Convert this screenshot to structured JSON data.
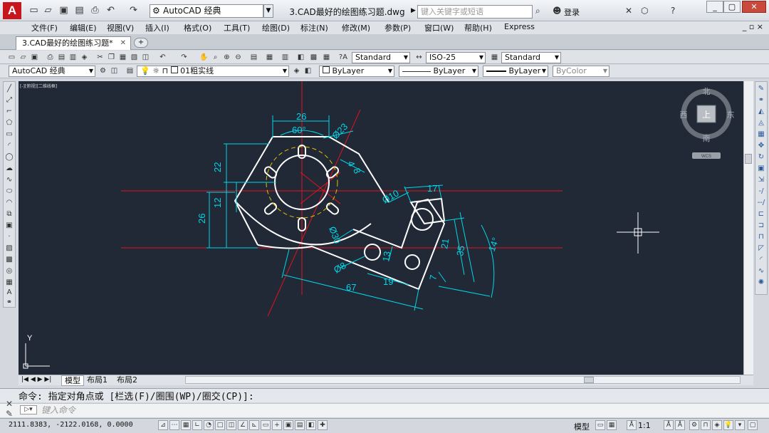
{
  "app": {
    "logo_letter": "A",
    "workspace": "AutoCAD 经典",
    "document_title": "3.CAD最好的绘图练习题.dwg",
    "search_placeholder": "键入关键字或短语",
    "login": "登录"
  },
  "menu": [
    "文件(F)",
    "编辑(E)",
    "视图(V)",
    "插入(I)",
    "格式(O)",
    "工具(T)",
    "绘图(D)",
    "标注(N)",
    "修改(M)",
    "参数(P)",
    "窗口(W)",
    "帮助(H)",
    "Express"
  ],
  "tabs": {
    "active": "3.CAD最好的绘图练习题*"
  },
  "styles": {
    "text_style": "Standard",
    "dim_style": "ISO-25",
    "table_style": "Standard"
  },
  "layers": {
    "workspace": "AutoCAD 经典",
    "current_layer": "01粗实线",
    "color": "ByLayer",
    "linetype": "ByLayer",
    "lineweight": "ByLayer",
    "plot_style": "ByColor"
  },
  "viewcube": {
    "north": "北",
    "south": "南",
    "west": "西",
    "east": "东",
    "top": "上",
    "wcs": "WCS"
  },
  "dimensions": {
    "d26_top": "26",
    "d60deg": "60°",
    "d23": "Ø23",
    "d22": "22",
    "d12": "12",
    "d26_left": "26",
    "d4": "4",
    "d8": "8",
    "d10": "Ø10",
    "d17": "17",
    "d30": "Ø30",
    "d21": "21",
    "d35": "35",
    "d14deg": "14°",
    "d13": "13",
    "d8b": "Ø8",
    "d19": "19",
    "d7": "7",
    "d67": "67"
  },
  "ucs": {
    "y_label": "Y"
  },
  "layout_tabs": [
    "模型",
    "布局1",
    "布局2"
  ],
  "command": {
    "history": "命令: 指定对角点或 [栏选(F)/圈围(WP)/圈交(CP)]:",
    "placeholder": "键入命令"
  },
  "status": {
    "coordinates": "2111.8383, -2122.0168, 0.0000",
    "model": "模型",
    "scale": "1:1"
  },
  "colors": {
    "canvas": "#212836",
    "geometry": "#ffffff",
    "dimension": "#00d7e8",
    "centerline": "#e0141e"
  }
}
